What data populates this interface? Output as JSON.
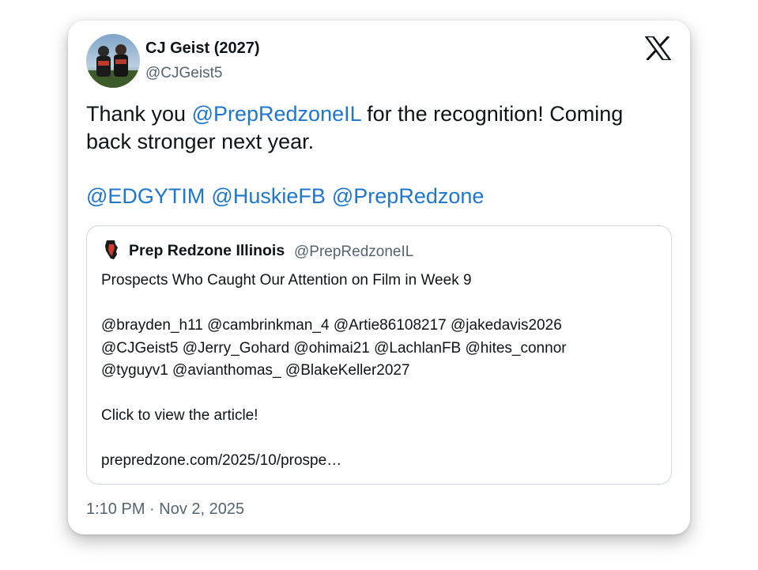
{
  "tweet": {
    "author_name": "CJ Geist (2027)",
    "author_handle": "@CJGeist5",
    "text_part1": "Thank you ",
    "text_mention": "@PrepRedzoneIL",
    "text_part2": " for the recognition! Coming back stronger next year.",
    "mentions": [
      "@EDGYTIM",
      "@HuskieFB",
      "@PrepRedzone"
    ],
    "timestamp": "1:10 PM · Nov 2, 2025"
  },
  "quote": {
    "author_name": "Prep Redzone Illinois",
    "author_handle": "@PrepRedzoneIL",
    "headline": "Prospects Who Caught Our Attention on Film in Week 9",
    "mention_lines": [
      "@brayden_h11 @cambrinkman_4 @Artie86108217 @jakedavis2026",
      "@CJGeist5 @Jerry_Gohard @ohimai21 @LachlanFB @hites_connor",
      "@tyguyv1 @avianthomas_ @BlakeKeller2027"
    ],
    "cta": "Click to view the article!",
    "link": "prepredzone.com/2025/10/prospe…"
  },
  "icons": {
    "brand": "x-logo-icon",
    "quote_logo": "illinois-state-logo-icon"
  },
  "colors": {
    "link": "#1d76d0",
    "text": "#0f1419",
    "muted": "#536471",
    "border": "#cfd9de"
  }
}
